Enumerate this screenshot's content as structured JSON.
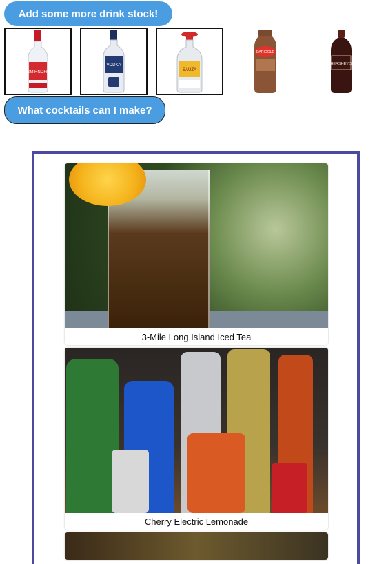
{
  "toolbar": {
    "add_stock_label": "Add some more drink stock!",
    "what_cocktails_label": "What cocktails can I make?"
  },
  "stock_items": [
    {
      "name": "vodka-red-bottle-icon",
      "label": "SMIRNOFF",
      "selected": true
    },
    {
      "name": "vodka-blue-bottle-icon",
      "label": "VODKA",
      "selected": true
    },
    {
      "name": "tequila-bottle-icon",
      "label": "SAUZA",
      "selected": true
    },
    {
      "name": "chocolate-milk-bottle-icon",
      "label": "DARIGOLD",
      "selected": false
    },
    {
      "name": "chocolate-syrup-bottle-icon",
      "label": "HERSHEY'S",
      "selected": false
    }
  ],
  "cocktails": [
    {
      "caption": "3-Mile Long Island Iced Tea",
      "image": "iced-tea-glass-photo"
    },
    {
      "caption": "Cherry Electric Lemonade",
      "image": "liquor-bottles-photo"
    }
  ],
  "colors": {
    "accent": "#4a9de0",
    "panel_border": "#4b4aa0"
  }
}
